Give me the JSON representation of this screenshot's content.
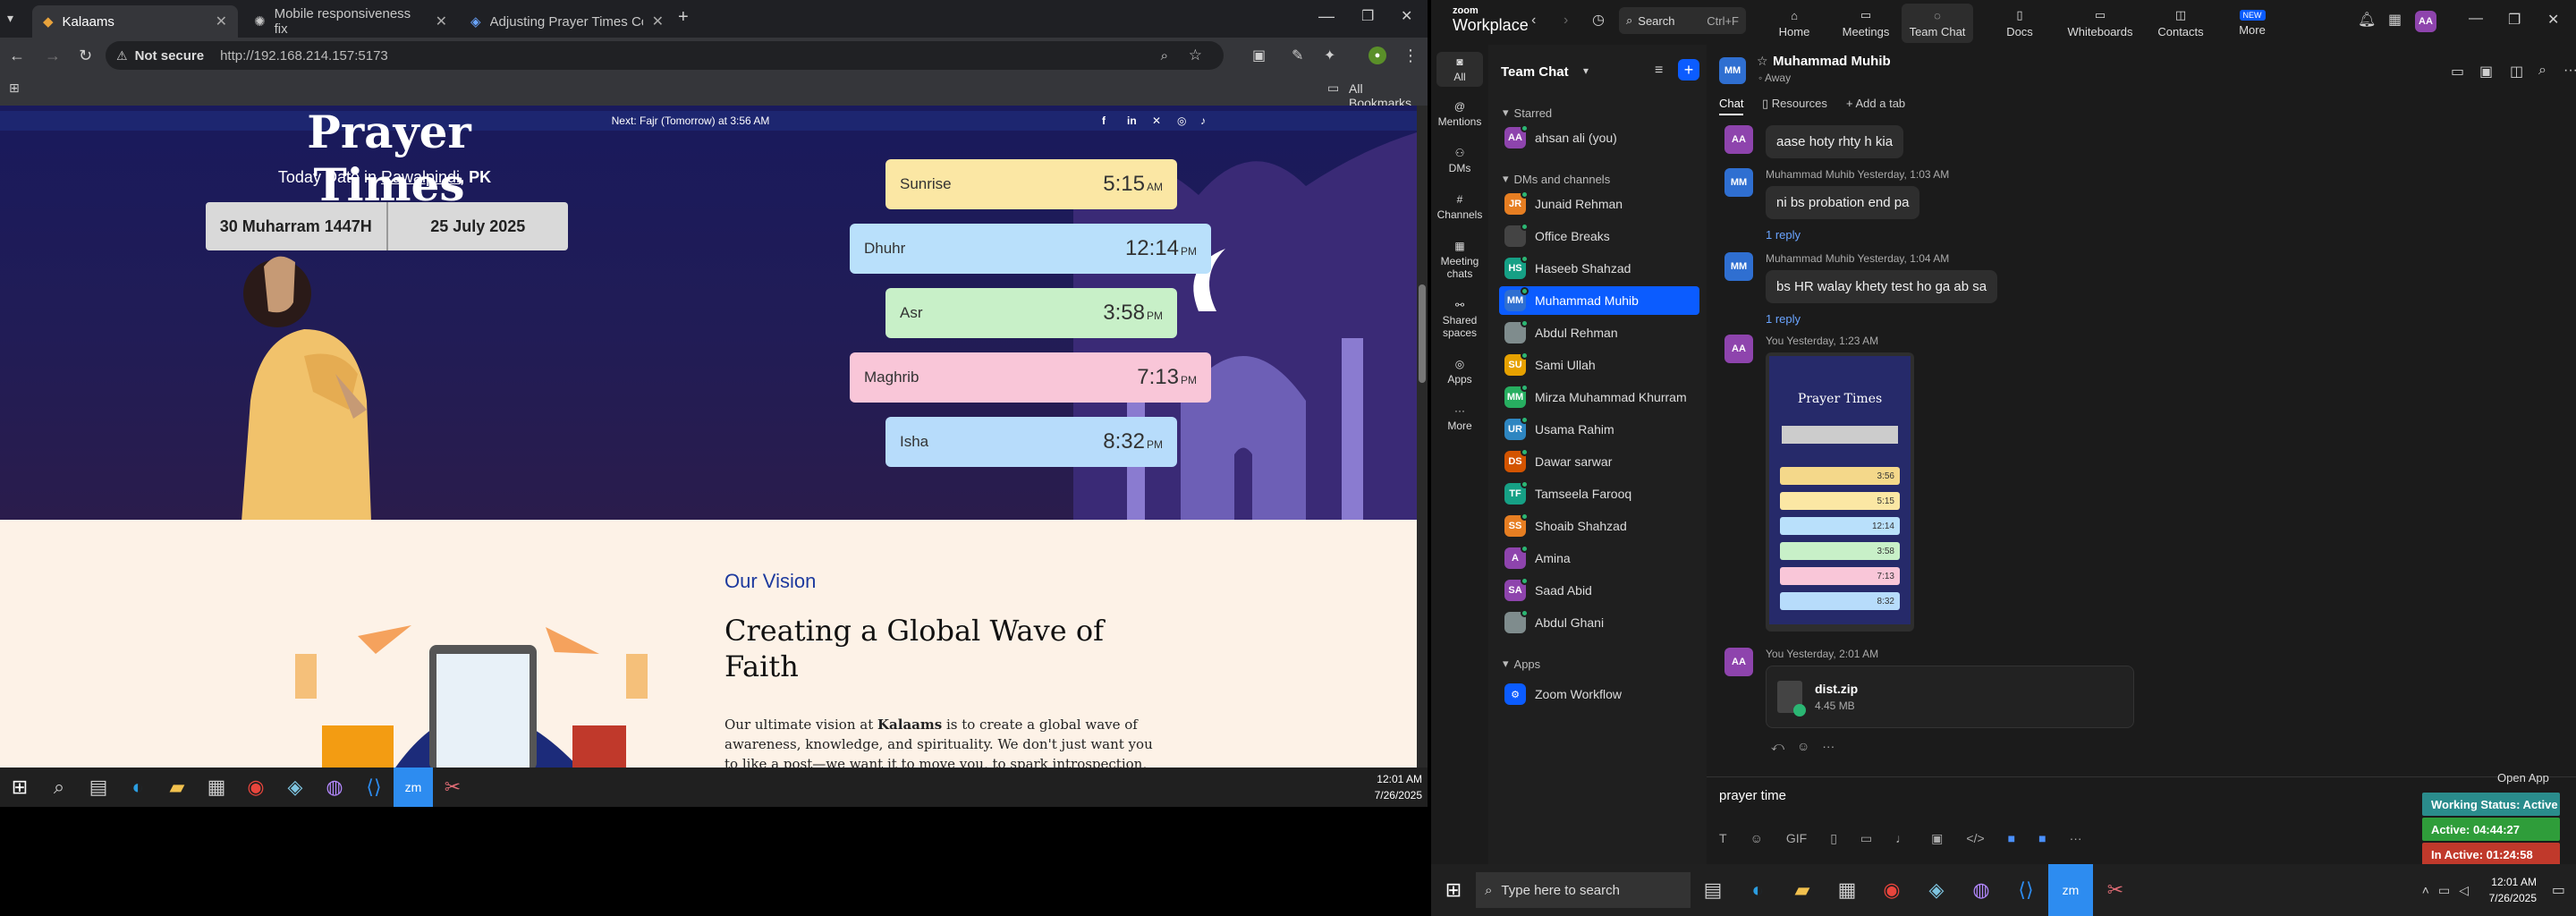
{
  "browser": {
    "tabs": [
      {
        "label": "Kalaams"
      },
      {
        "label": "Mobile responsiveness fix"
      },
      {
        "label": "Adjusting Prayer Times Contain"
      }
    ],
    "address": {
      "security": "Not secure",
      "url": "http://192.168.214.157:5173"
    },
    "bookmarks": "All Bookmarks"
  },
  "site": {
    "next_prayer": "Next: Fajr (Tomorrow) at 3:56 AM",
    "title": "Prayer Times",
    "today_label": "Today Date in",
    "city": "Rawalpindi",
    "country": ", PK",
    "hijri": "30 Muharram 1447H",
    "gregorian": "25 July 2025",
    "prayers": [
      {
        "name": "Sunrise",
        "time": "5:15",
        "ampm": "AM",
        "color": "#fbe7a4"
      },
      {
        "name": "Dhuhr",
        "time": "12:14",
        "ampm": "PM",
        "color": "#b9e0fb"
      },
      {
        "name": "Asr",
        "time": "3:58",
        "ampm": "PM",
        "color": "#c8f0c8"
      },
      {
        "name": "Maghrib",
        "time": "7:13",
        "ampm": "PM",
        "color": "#f9c6d8"
      },
      {
        "name": "Isha",
        "time": "8:32",
        "ampm": "PM",
        "color": "#b7dcfb"
      }
    ],
    "vision_label": "Our Vision",
    "vision_title": "Creating a Global Wave of Faith",
    "vision_text_1": "Our ultimate vision at ",
    "vision_brand": "Kalaams",
    "vision_text_2": " is to create a global wave of awareness, knowledge, and spirituality. We don't just want you to like a post—we want it to move you, to spark introspection, and to"
  },
  "taskbar_left": {
    "time": "12:01 AM",
    "date": "7/26/2025"
  },
  "zoom": {
    "brand_top": "zoom",
    "brand": "Workplace",
    "search": "Search",
    "shortcut": "Ctrl+F",
    "nav": [
      {
        "label": "Home"
      },
      {
        "label": "Meetings"
      },
      {
        "label": "Team Chat"
      },
      {
        "label": "Docs"
      },
      {
        "label": "Whiteboards"
      },
      {
        "label": "Contacts"
      },
      {
        "label": "More"
      }
    ],
    "new_badge": "NEW",
    "user_initials": "AA",
    "sidebar": [
      {
        "label": "All"
      },
      {
        "label": "Mentions"
      },
      {
        "label": "DMs"
      },
      {
        "label": "Channels"
      },
      {
        "label": "Meeting chats"
      },
      {
        "label": "Shared spaces"
      },
      {
        "label": "Apps"
      },
      {
        "label": "More"
      }
    ],
    "list_title": "Team Chat",
    "starred": "Starred",
    "dms_channels": "DMs and channels",
    "apps": "Apps",
    "starred_items": [
      {
        "name": "ahsan ali (you)",
        "initials": "AA",
        "color": "#8e44ad"
      }
    ],
    "contacts": [
      {
        "name": "Junaid Rehman",
        "initials": "JR",
        "color": "#e67e22"
      },
      {
        "name": "Office Breaks",
        "initials": "",
        "color": "#444"
      },
      {
        "name": "Haseeb Shahzad",
        "initials": "HS",
        "color": "#16a085"
      },
      {
        "name": "Muhammad Muhib",
        "initials": "MM",
        "color": "#2f6fd1"
      },
      {
        "name": "Abdul Rehman",
        "initials": "",
        "color": "#7f8c8d"
      },
      {
        "name": "Sami Ullah",
        "initials": "SU",
        "color": "#e6a100"
      },
      {
        "name": "Mirza Muhammad Khurram",
        "initials": "MM",
        "color": "#27ae60"
      },
      {
        "name": "Usama Rahim",
        "initials": "UR",
        "color": "#2e86c1"
      },
      {
        "name": "Dawar sarwar",
        "initials": "DS",
        "color": "#d35400"
      },
      {
        "name": "Tamseela Farooq",
        "initials": "TF",
        "color": "#16a085"
      },
      {
        "name": "Shoaib Shahzad",
        "initials": "SS",
        "color": "#e67e22"
      },
      {
        "name": "Amina",
        "initials": "A",
        "color": "#8e44ad"
      },
      {
        "name": "Saad Abid",
        "initials": "SA",
        "color": "#8e44ad"
      },
      {
        "name": "Abdul Ghani",
        "initials": "",
        "color": "#7f8c8d"
      }
    ],
    "app_items": [
      {
        "name": "Zoom Workflow"
      }
    ],
    "chat": {
      "name": "Muhammad Muhib",
      "initials": "MM",
      "status": "Away",
      "tabs": [
        {
          "label": "Chat"
        },
        {
          "label": "Resources"
        },
        {
          "label": "Add a tab"
        }
      ],
      "messages": [
        {
          "initials": "AA",
          "text": "aase hoty rhty h kia"
        },
        {
          "initials": "MM",
          "meta": "Muhammad Muhib Yesterday, 1:03 AM",
          "text": "ni bs probation end pa",
          "reply": "1 reply"
        },
        {
          "initials": "MM",
          "meta": "Muhammad Muhib Yesterday, 1:04 AM",
          "text": "bs HR walay khety test ho ga ab sa",
          "reply": "1 reply"
        },
        {
          "initials": "AA",
          "meta": "You Yesterday, 1:23 AM"
        },
        {
          "initials": "AA",
          "meta": "You Yesterday, 2:01 AM",
          "file": "dist.zip",
          "size": "4.45 MB"
        }
      ],
      "thumb": {
        "title": "Prayer Times",
        "rows": [
          "3:56",
          "5:15",
          "12:14",
          "3:58",
          "7:13",
          "8:32"
        ]
      },
      "input": "prayer time",
      "open_app": "Open App"
    },
    "status": {
      "working": "Working Status: Active",
      "active": "Active: 04:44:27",
      "inactive": "In Active: 01:24:58"
    }
  },
  "taskbar_right": {
    "search": "Type here to search",
    "time": "12:01 AM",
    "date": "7/26/2025"
  }
}
